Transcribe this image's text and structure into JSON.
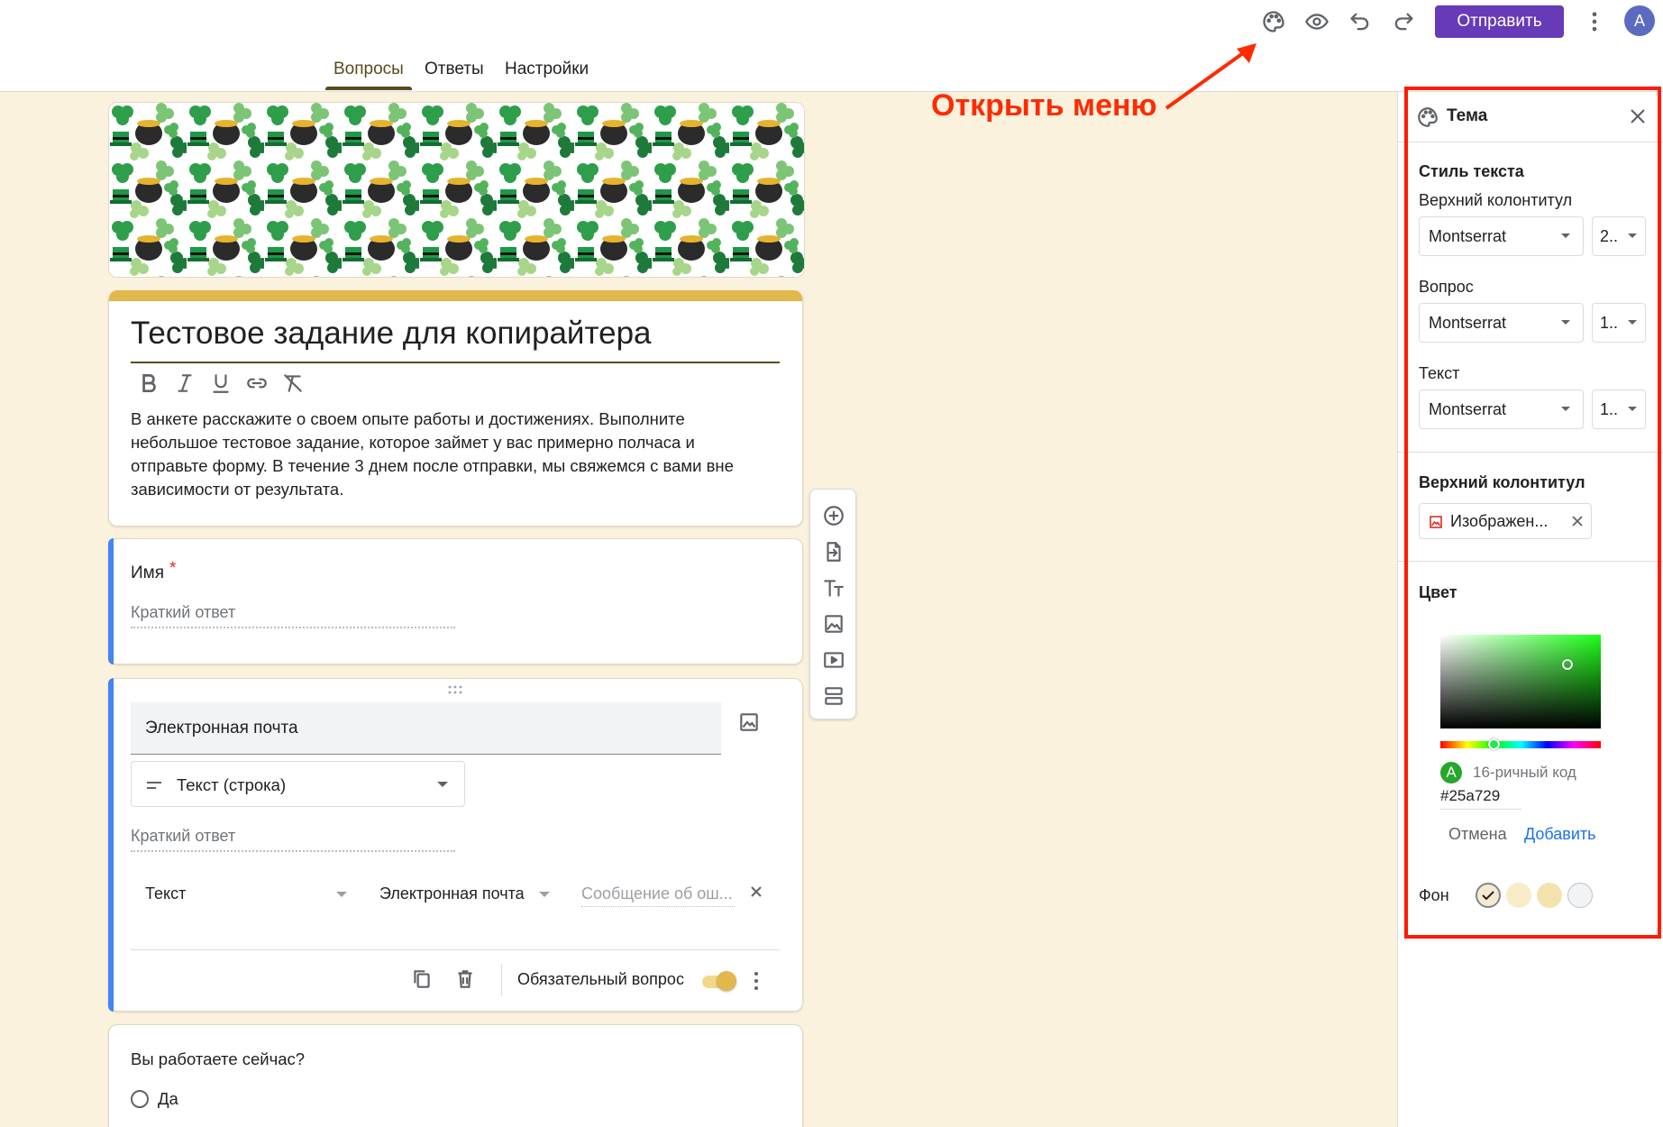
{
  "topbar": {
    "send_label": "Отправить",
    "avatar_letter": "A",
    "icons": [
      "palette-icon",
      "eye-icon",
      "undo-icon",
      "redo-icon",
      "more-vert-icon"
    ]
  },
  "tabs": [
    "Вопросы",
    "Ответы",
    "Настройки"
  ],
  "form": {
    "title": "Тестовое задание для копирайтера",
    "description": "В анкете расскажите о своем опыте работы и достижениях. Выполните небольшое тестовое задание, которое займет у вас примерно полчаса и отправьте форму. В течение 3 днем после отправки, мы свяжемся с вами вне зависимости от результата.",
    "accent_color": "#e2b74b"
  },
  "q_name": {
    "title": "Имя",
    "required_mark": "*",
    "placeholder": "Краткий ответ"
  },
  "q_email": {
    "title": "Электронная почта",
    "type_label": "Текст (строка)",
    "placeholder": "Краткий ответ",
    "validation_type": "Текст",
    "validation_rule": "Электронная почта",
    "error_placeholder": "Сообщение об ош...",
    "required_label": "Обязательный вопрос"
  },
  "q_work": {
    "title": "Вы работаете сейчас?",
    "option1": "Да"
  },
  "panel": {
    "title": "Тема",
    "text_style": "Стиль текста",
    "header_label": "Верхний колонтитул",
    "header_font": "Montserrat",
    "header_size": "2..",
    "question_label": "Вопрос",
    "question_font": "Montserrat",
    "question_size": "1..",
    "text_label": "Текст",
    "text_font": "Montserrat",
    "text_size": "1..",
    "header_section": "Верхний колонтитул",
    "header_image": "Изображен...",
    "color_section": "Цвет",
    "hex_label": "16-ричный код",
    "hex_value": "#25a729",
    "cancel": "Отмена",
    "add": "Добавить",
    "background_label": "Фон",
    "swatches": [
      "#f5ead0",
      "#f8ecc8",
      "#f4e2ad",
      "#f1f3f4"
    ],
    "selected_color": "#25a729"
  },
  "annotation": {
    "text": "Открыть меню",
    "color": "#ff2a00"
  }
}
